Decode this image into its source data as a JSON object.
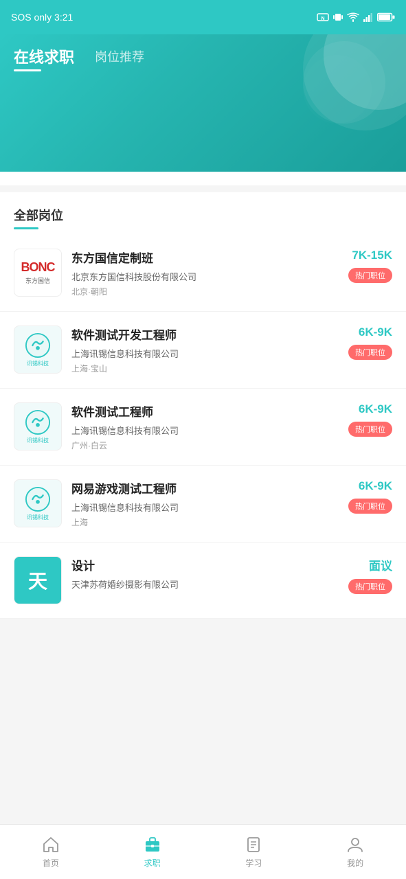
{
  "statusBar": {
    "leftText": "SOS only 3:21",
    "icons": [
      "notification",
      "download",
      "screenshot",
      "nfc",
      "vibrate",
      "wifi",
      "signal",
      "battery"
    ]
  },
  "header": {
    "tabs": [
      {
        "label": "在线求职",
        "active": true
      },
      {
        "label": "岗位推荐",
        "active": false
      }
    ]
  },
  "sectionTitle": "全部岗位",
  "jobs": [
    {
      "id": 1,
      "title": "东方国信定制班",
      "company": "北京东方国信科技股份有限公司",
      "location": "北京·朝阳",
      "salary": "7K-15K",
      "badge": "热门职位",
      "logoType": "bonc"
    },
    {
      "id": 2,
      "title": "软件测试开发工程师",
      "company": "上海讯锡信息科技有限公司",
      "location": "上海·宝山",
      "salary": "6K-9K",
      "badge": "热门职位",
      "logoType": "xunxi"
    },
    {
      "id": 3,
      "title": "软件测试工程师",
      "company": "上海讯锡信息科技有限公司",
      "location": "广州·白云",
      "salary": "6K-9K",
      "badge": "热门职位",
      "logoType": "xunxi"
    },
    {
      "id": 4,
      "title": "网易游戏测试工程师",
      "company": "上海讯锡信息科技有限公司",
      "location": "上海",
      "salary": "6K-9K",
      "badge": "热门职位",
      "logoType": "xunxi"
    },
    {
      "id": 5,
      "title": "设计",
      "company": "天津苏荷婚纱摄影有限公司",
      "location": "",
      "salary": "面议",
      "badge": "热门职位",
      "logoType": "tian"
    }
  ],
  "bottomNav": [
    {
      "label": "首页",
      "icon": "home",
      "active": false
    },
    {
      "label": "求职",
      "icon": "job",
      "active": true
    },
    {
      "label": "学习",
      "icon": "learn",
      "active": false
    },
    {
      "label": "我的",
      "icon": "profile",
      "active": false
    }
  ]
}
